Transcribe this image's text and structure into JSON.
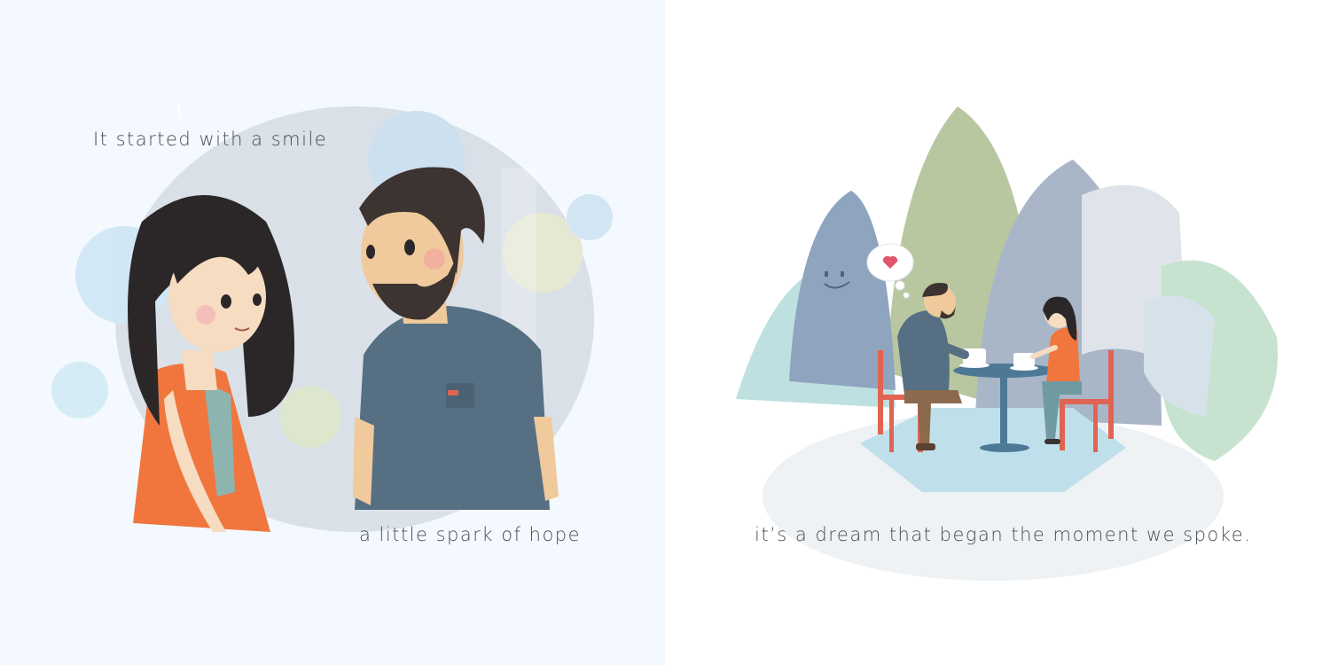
{
  "pages": {
    "left": {
      "captions": [
        "It started with a smile",
        "a little spark of hope"
      ]
    },
    "right": {
      "caption": "it’s a dream that began the moment we spoke."
    }
  },
  "icons": [
    "heart-icon",
    "thought-bubble-icon",
    "coffee-cup-icon",
    "crescent-moon-icon"
  ],
  "colors": {
    "left_page_bg": "#f3f9fe",
    "right_page_bg": "#ffffff",
    "orange_top": "#f0763e",
    "navy_shirt": "#566f83",
    "red_chair": "#e06451",
    "hair": "#2b2728",
    "skin": "#f6dcc0",
    "caption_text": "#4a4d52"
  }
}
